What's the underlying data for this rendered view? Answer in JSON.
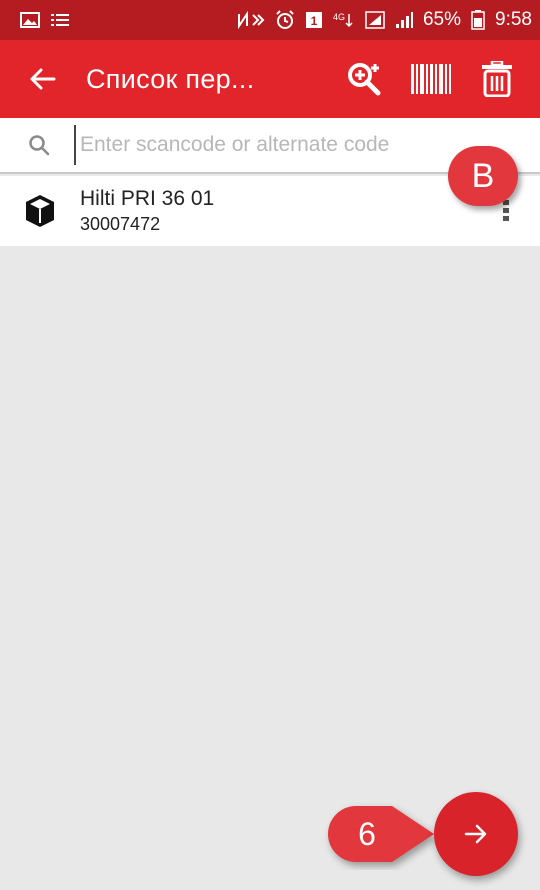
{
  "status_bar": {
    "battery_percent": "65%",
    "time": "9:58",
    "icons": [
      "gallery-icon",
      "list-icon",
      "nfc-icon",
      "alarm-icon",
      "data-icon",
      "lte-icon",
      "signal-icon",
      "battery-icon"
    ]
  },
  "app_bar": {
    "title": "Список пер...",
    "back_icon": "arrow-left-icon",
    "actions": [
      "search-add-icon",
      "barcode-icon",
      "trash-icon"
    ]
  },
  "search": {
    "placeholder": "Enter scancode or alternate code",
    "value": ""
  },
  "items": [
    {
      "name": "Hilti PRI 36 01",
      "code": "30007472",
      "icon": "box-icon"
    }
  ],
  "annotations": {
    "b_label": "B",
    "six_label": "6"
  },
  "colors": {
    "status_bar": "#b41c22",
    "app_bar": "#e2242b",
    "accent": "#d8232a",
    "background": "#e8e8e8"
  }
}
